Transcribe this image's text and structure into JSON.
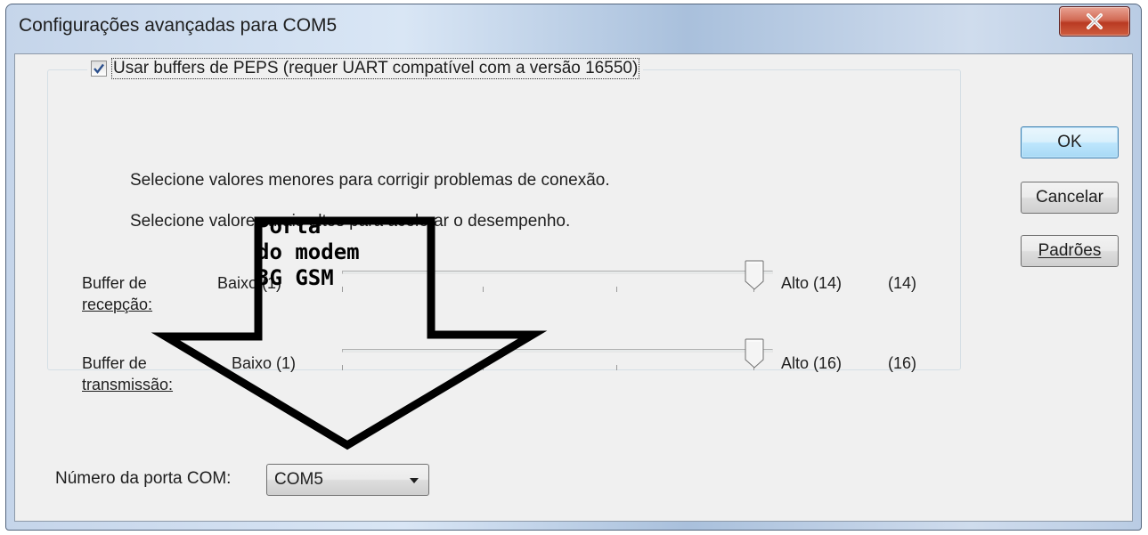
{
  "window": {
    "title": "Configurações avançadas para COM5",
    "close_icon": "close-x-icon"
  },
  "fifo": {
    "checked": true,
    "label": "Usar buffers de PEPS (requer UART compatível com a versão 16550)",
    "hint_low": "Selecione valores menores para corrigir problemas de conexão.",
    "hint_high": "Selecione valores mais altos para acelerar o desempenho."
  },
  "receive_buffer": {
    "label_line1": "Buffer de",
    "label_line2": "recepção:",
    "min_label": "Baixo (1)",
    "max_label": "Alto (14)",
    "current": "(14)",
    "value": 14,
    "min": 1,
    "max": 14
  },
  "transmit_buffer": {
    "label_line1": "Buffer de",
    "label_line2": "transmissão:",
    "min_label": "Baixo (1)",
    "max_label": "Alto (16)",
    "current": "(16)",
    "value": 16,
    "min": 1,
    "max": 16
  },
  "port": {
    "label": "Número da porta COM:",
    "value": "COM5"
  },
  "buttons": {
    "ok": "OK",
    "cancel": "Cancelar",
    "defaults": "Padrões"
  },
  "annotation": {
    "line1": "Porta",
    "line2": "do modem",
    "line3": "3G GSM"
  }
}
